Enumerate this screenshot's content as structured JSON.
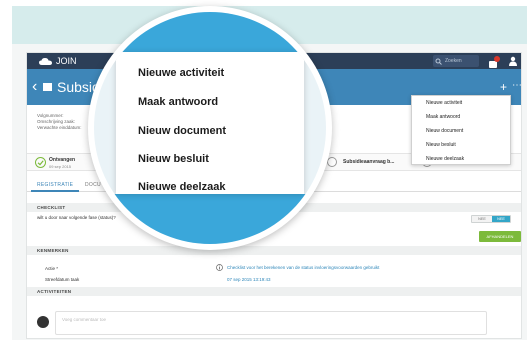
{
  "topbar": {
    "logo_text": "JOIN",
    "search_placeholder": "Zoeken"
  },
  "header": {
    "title": "Subsid"
  },
  "metadata": {
    "lines": [
      "Volgnummer:",
      "Omschrijving zaak:",
      "Verwachte einddatum:"
    ]
  },
  "steps": {
    "first_label": "Ontvangen",
    "first_date": "09 sep 2015",
    "other_label": "Subsidieaanvraag b..."
  },
  "tabs": {
    "registratie": "REGISTRATIE",
    "documenten": "DOCU"
  },
  "checklist": {
    "header": "CHECKLIST",
    "question": "wilt u door naar volgende fase (status)?",
    "toggle_no": "NEE",
    "toggle_yes": "NEE",
    "submit": "AFHANDELEN"
  },
  "kenmerken": {
    "header": "KENMERKEN",
    "actie_label": "Actie *",
    "actie_value": "Checklist voor het berekenen van de status invloeringsvoorwaarden gebruikt",
    "streef_label": "Streefdatum taak",
    "streef_value": "07 sep 2015 13:19:43"
  },
  "activiteiten": {
    "header": "ACTIVITEITEN",
    "comment_placeholder": "Voeg commentaar toe"
  },
  "dropdown": {
    "items": [
      "Nieuwe activiteit",
      "Maak antwoord",
      "Nieuw document",
      "Nieuw besluit",
      "Nieuwe deelzaak"
    ]
  },
  "magnified_menu": {
    "items": [
      "Nieuwe activiteit",
      "Maak antwoord",
      "Nieuw document",
      "Nieuw besluit",
      "Nieuwe deelzaak"
    ]
  },
  "colors": {
    "banner": "#d6ecec",
    "topbar": "#2c3f58",
    "header": "#3e86b8",
    "accent_blue": "#3aa7da",
    "success_green": "#7cba3b",
    "badge_red": "#d9372b"
  }
}
